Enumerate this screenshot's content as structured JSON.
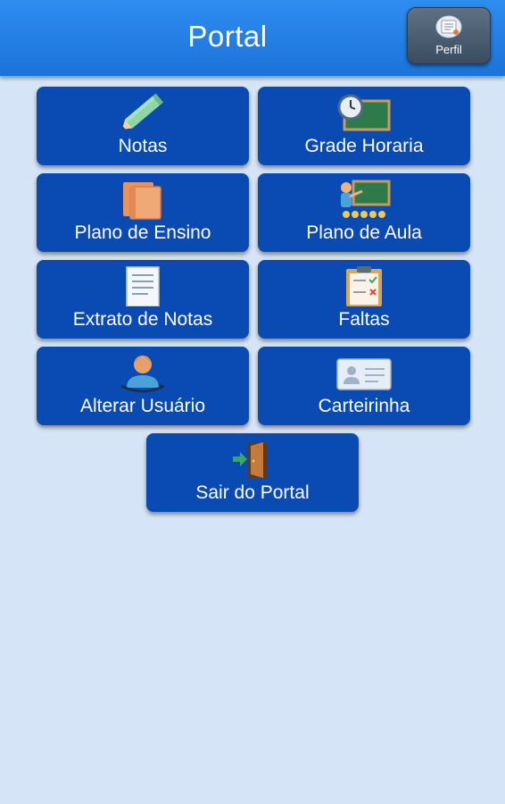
{
  "header": {
    "title": "Portal",
    "perfil_label": "Perfil"
  },
  "menu": {
    "notas": "Notas",
    "grade_horaria": "Grade Horaria",
    "plano_ensino": "Plano de Ensino",
    "plano_aula": "Plano de Aula",
    "extrato_notas": "Extrato de Notas",
    "faltas": "Faltas",
    "alterar_usuario": "Alterar Usuário",
    "carteirinha": "Carteirinha",
    "sair": "Sair do Portal"
  },
  "icons": {
    "notas": "pencil-icon",
    "grade_horaria": "clock-blackboard-icon",
    "plano_ensino": "books-icon",
    "plano_aula": "teacher-blackboard-icon",
    "extrato_notas": "document-icon",
    "faltas": "clipboard-checklist-icon",
    "alterar_usuario": "user-switch-icon",
    "carteirinha": "id-card-icon",
    "sair": "exit-door-icon",
    "perfil": "profile-icon"
  },
  "colors": {
    "topbar": "#1f7ce3",
    "button": "#0a4ab3",
    "background": "#d6e4f7",
    "perfil_button": "#4a5c70"
  }
}
